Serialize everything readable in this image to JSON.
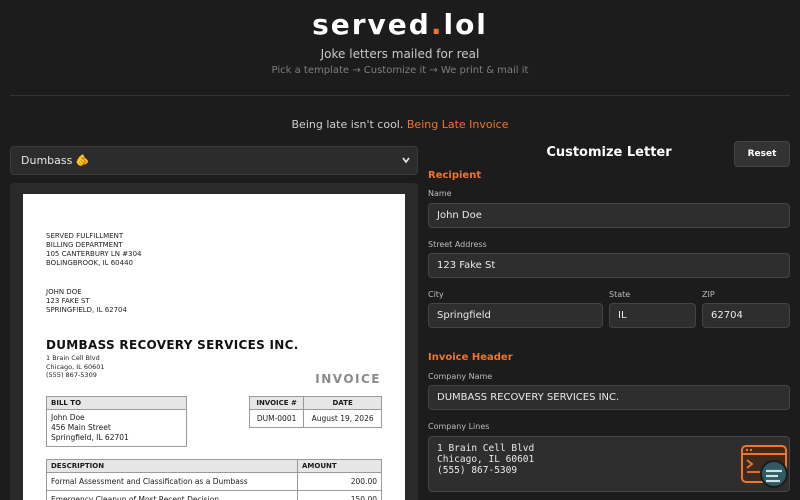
{
  "header": {
    "brand_name": "served",
    "brand_dot": ".",
    "brand_tld": "lol",
    "tagline": "Joke letters mailed for real",
    "steps": "Pick a template → Customize it → We print & mail it"
  },
  "promo": {
    "text": "Being late isn't cool. ",
    "link_label": "Being Late Invoice"
  },
  "template_select": {
    "value": "Dumbass 🫵",
    "chevron_icon": "chevron-down-icon"
  },
  "letter": {
    "sender_lines": [
      "SERVED FULFILLMENT",
      "BILLING DEPARTMENT",
      "105 CANTERBURY LN #304",
      "BOLINGBROOK, IL 60440"
    ],
    "recipient_lines": [
      "JOHN DOE",
      "123 FAKE ST",
      "SPRINGFIELD, IL 62704"
    ],
    "company_name": "DUMBASS RECOVERY SERVICES INC.",
    "company_lines": [
      "1 Brain Cell Blvd",
      "Chicago, IL 60601",
      "(555) 867-5309"
    ],
    "invoice_title": "INVOICE",
    "bill_to_header": "BILL TO",
    "bill_to_lines": [
      "John Doe",
      "456 Main Street",
      "Springfield, IL 62701"
    ],
    "invoice_number_header": "INVOICE #",
    "date_header": "DATE",
    "invoice_number": "DUM-0001",
    "invoice_date": "August 19, 2026",
    "items_header_description": "DESCRIPTION",
    "items_header_amount": "AMOUNT",
    "items": [
      {
        "description": "Formal Assessment and Classification as a Dumbass",
        "amount": "200.00"
      },
      {
        "description": "Emergency Cleanup of Most Recent Decision",
        "amount": "150.00"
      }
    ]
  },
  "panel": {
    "title": "Customize Letter",
    "reset_label": "Reset",
    "recipient_section": "Recipient",
    "name_label": "Name",
    "name_value": "John Doe",
    "street_label": "Street Address",
    "street_value": "123 Fake St",
    "city_label": "City",
    "city_value": "Springfield",
    "state_label": "State",
    "state_value": "IL",
    "zip_label": "ZIP",
    "zip_value": "62704",
    "invoice_section": "Invoice Header",
    "company_name_label": "Company Name",
    "company_name_value": "DUMBASS RECOVERY SERVICES INC.",
    "company_lines_label": "Company Lines",
    "company_lines_value": "1 Brain Cell Blvd\nChicago, IL 60601\n(555) 867-5309"
  },
  "widget": {
    "icon": "terminal-window-icon"
  },
  "colors": {
    "accent": "#f0752a",
    "background": "#1c1c1c",
    "input_bg": "#2e2e2e",
    "widget_teal": "#2f5a63"
  }
}
